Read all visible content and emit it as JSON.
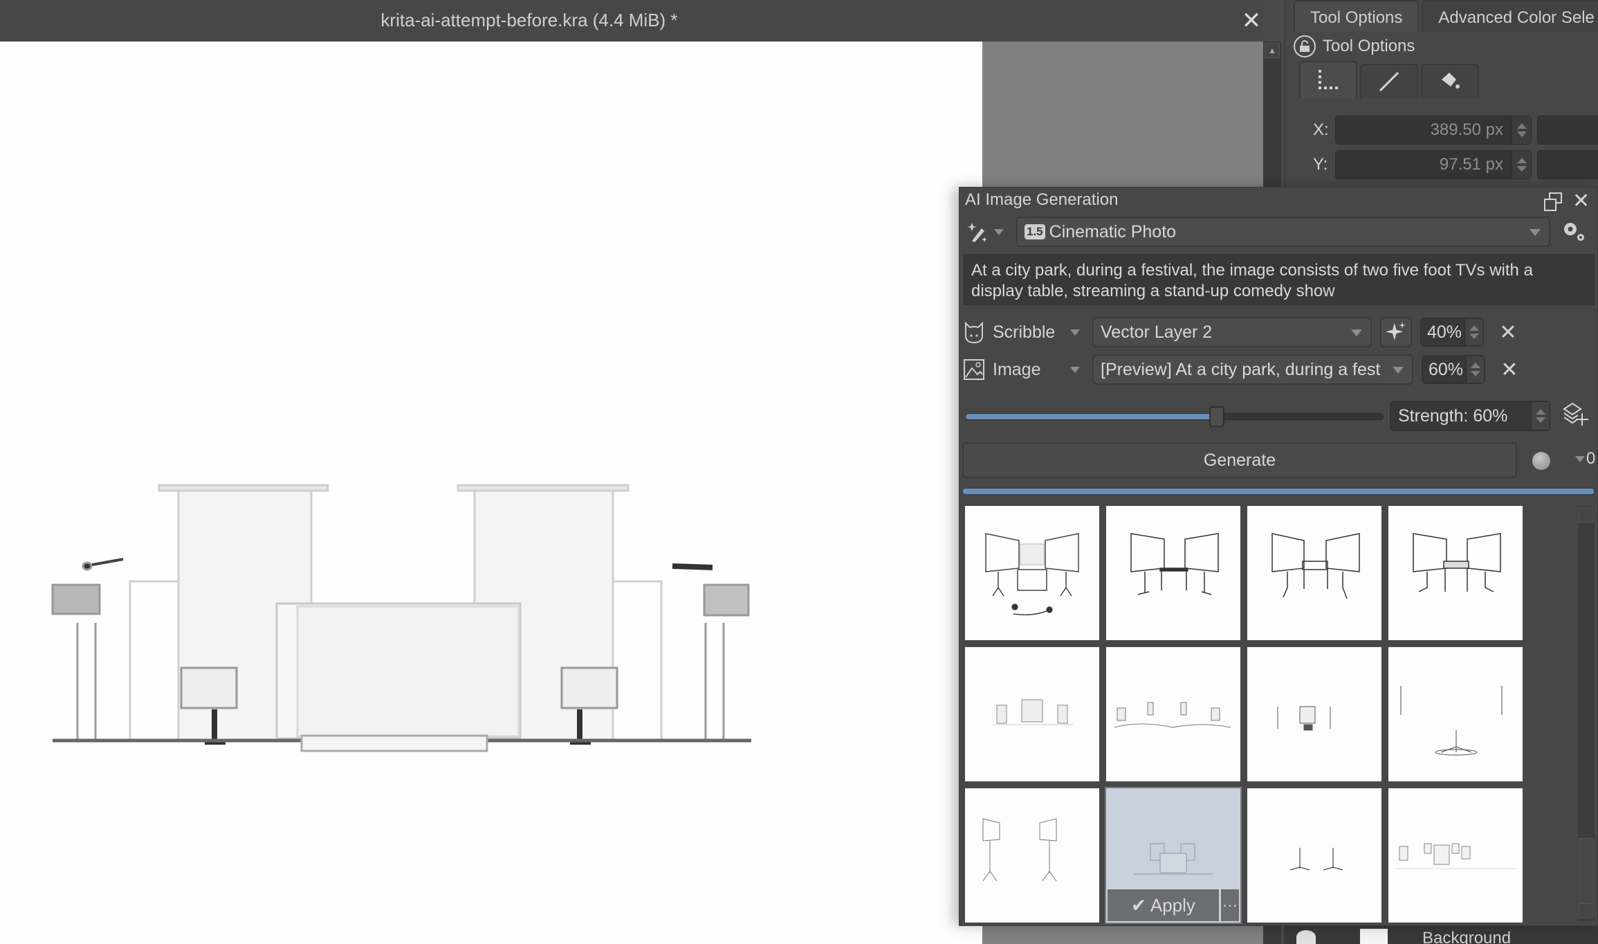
{
  "document": {
    "title": "krita-ai-attempt-before.kra (4.4 MiB) *",
    "close_icon": "close-icon"
  },
  "right_dock": {
    "tabs": [
      {
        "label": "Tool Options",
        "active": true
      },
      {
        "label": "Advanced Color Sele",
        "active": false
      }
    ],
    "header": "Tool Options",
    "tool_subtabs": [
      "rectangle-selection-icon",
      "line-icon",
      "fill-bucket-icon"
    ],
    "x_label": "X:",
    "x_value": "389.50 px",
    "y_label": "Y:",
    "y_value": "97.51 px",
    "layer_name": "Background"
  },
  "ai_panel": {
    "title": "AI Image Generation",
    "style": {
      "badge": "1.5",
      "name": "Cinematic Photo"
    },
    "prompt": "At a city park, during a festival, the image consists of two five foot TVs with a display table, streaming a stand-up comedy show",
    "controls": [
      {
        "type": "Scribble",
        "icon": "cat-icon",
        "layer": "Vector Layer 2",
        "strength": "40%"
      },
      {
        "type": "Image",
        "icon": "image-icon",
        "layer": "[Preview] At a city park, during a fest",
        "strength": "60%"
      }
    ],
    "strength": {
      "label": "Strength: 60%",
      "value": 0.6
    },
    "generate_label": "Generate",
    "queue_count": "0",
    "progress": 1.0,
    "results": {
      "count": 12,
      "selected_index": 9,
      "apply_label": "Apply",
      "more_label": "···"
    }
  }
}
